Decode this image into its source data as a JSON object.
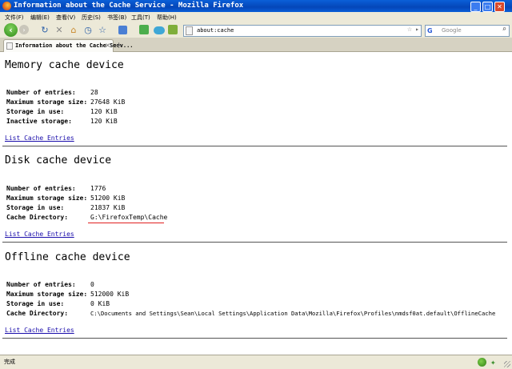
{
  "window": {
    "title": "Information about the Cache Service - Mozilla Firefox",
    "min_glyph": "_",
    "max_glyph": "□",
    "close_glyph": "✕"
  },
  "menu": [
    "文件(F)",
    "编辑(E)",
    "查看(V)",
    "历史(S)",
    "书签(B)",
    "工具(T)",
    "帮助(H)"
  ],
  "toolbar": {
    "back_glyph": "‹",
    "forward_glyph": "›",
    "reload_glyph": "↻",
    "stop_glyph": "✕",
    "home_glyph": "⌂",
    "history_glyph": "◷",
    "bookmark_glyph": "☆",
    "icons": [
      "back-icon",
      "forward-icon",
      "reload-icon",
      "stop-icon",
      "home-icon",
      "history-icon",
      "bookmark-star-icon"
    ]
  },
  "address_bar": {
    "value": "about:cache",
    "star_glyph": "☆",
    "go_glyph": "▸"
  },
  "search_bar": {
    "engine_glyph": "G",
    "placeholder": "Google",
    "search_glyph": "⌕"
  },
  "tab": {
    "label": "Information about the Cache Serv...",
    "close_glyph": "×",
    "new_tab_glyph": "+"
  },
  "sections": [
    {
      "title": "Memory cache device",
      "rows": [
        {
          "label": "Number of entries:",
          "value": "28"
        },
        {
          "label": "Maximum storage size:",
          "value": "27648 KiB"
        },
        {
          "label": "Storage in use:",
          "value": "120 KiB"
        },
        {
          "label": "Inactive storage:",
          "value": "120 KiB"
        }
      ],
      "link": "List Cache Entries"
    },
    {
      "title": "Disk cache device",
      "rows": [
        {
          "label": "Number of entries:",
          "value": "1776"
        },
        {
          "label": "Maximum storage size:",
          "value": "51200 KiB"
        },
        {
          "label": "Storage in use:",
          "value": "21837 KiB"
        },
        {
          "label": "Cache Directory:",
          "value": "G:\\FirefoxTemp\\Cache"
        }
      ],
      "link": "List Cache Entries"
    },
    {
      "title": "Offline cache device",
      "rows": [
        {
          "label": "Number of entries:",
          "value": "0"
        },
        {
          "label": "Maximum storage size:",
          "value": "512000 KiB"
        },
        {
          "label": "Storage in use:",
          "value": "0 KiB"
        },
        {
          "label": "Cache Directory:",
          "value": "C:\\Documents and Settings\\Sean\\Local Settings\\Application Data\\Mozilla\\Firefox\\Profiles\\nmdsf0at.default\\OfflineCache"
        }
      ],
      "link": "List Cache Entries"
    }
  ],
  "status": {
    "text": "完成"
  },
  "colors": {
    "titlebar": "#0a5fd8",
    "chrome": "#ece9d8",
    "link": "#1a0dab",
    "annotation": "#e12020"
  }
}
